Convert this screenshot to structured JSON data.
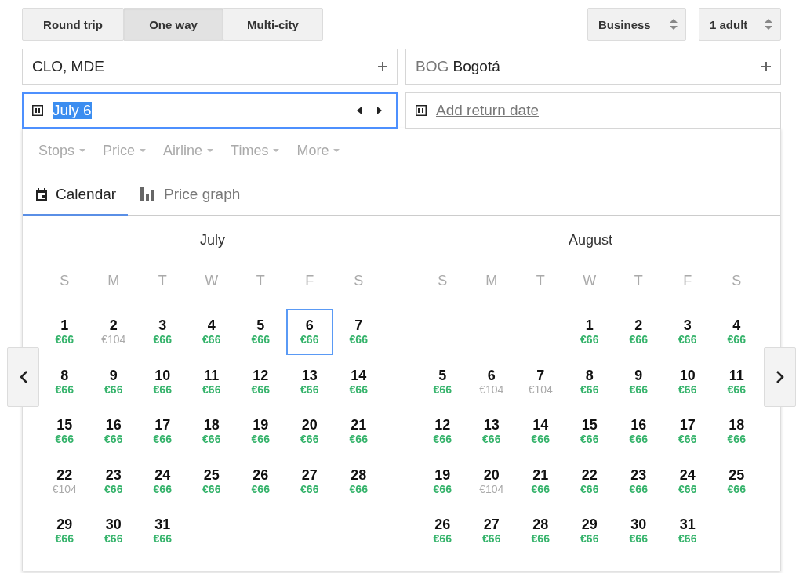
{
  "trip_types": [
    {
      "label": "Round trip",
      "selected": false
    },
    {
      "label": "One way",
      "selected": true
    },
    {
      "label": "Multi-city",
      "selected": false
    }
  ],
  "cabin": {
    "value": "Business"
  },
  "passengers": {
    "value": "1 adult"
  },
  "origin": {
    "value": "CLO, MDE"
  },
  "destination": {
    "code": "BOG",
    "city": "Bogotá"
  },
  "departure": {
    "value": "July 6"
  },
  "return_date": {
    "label": "Add return date"
  },
  "filters": [
    "Stops",
    "Price",
    "Airline",
    "Times",
    "More"
  ],
  "view_tabs": [
    {
      "label": "Calendar",
      "kind": "calendar",
      "selected": true
    },
    {
      "label": "Price graph",
      "kind": "graph",
      "selected": false
    }
  ],
  "months": [
    {
      "title": "July",
      "weekdays": [
        "S",
        "M",
        "T",
        "W",
        "T",
        "F",
        "S"
      ],
      "weeks": [
        [
          {
            "day": "1",
            "price": "€66",
            "low": true,
            "selected": false
          },
          {
            "day": "2",
            "price": "€104",
            "low": false,
            "selected": false
          },
          {
            "day": "3",
            "price": "€66",
            "low": true,
            "selected": false
          },
          {
            "day": "4",
            "price": "€66",
            "low": true,
            "selected": false
          },
          {
            "day": "5",
            "price": "€66",
            "low": true,
            "selected": false
          },
          {
            "day": "6",
            "price": "€66",
            "low": true,
            "selected": true
          },
          {
            "day": "7",
            "price": "€66",
            "low": true,
            "selected": false
          }
        ],
        [
          {
            "day": "8",
            "price": "€66",
            "low": true,
            "selected": false
          },
          {
            "day": "9",
            "price": "€66",
            "low": true,
            "selected": false
          },
          {
            "day": "10",
            "price": "€66",
            "low": true,
            "selected": false
          },
          {
            "day": "11",
            "price": "€66",
            "low": true,
            "selected": false
          },
          {
            "day": "12",
            "price": "€66",
            "low": true,
            "selected": false
          },
          {
            "day": "13",
            "price": "€66",
            "low": true,
            "selected": false
          },
          {
            "day": "14",
            "price": "€66",
            "low": true,
            "selected": false
          }
        ],
        [
          {
            "day": "15",
            "price": "€66",
            "low": true,
            "selected": false
          },
          {
            "day": "16",
            "price": "€66",
            "low": true,
            "selected": false
          },
          {
            "day": "17",
            "price": "€66",
            "low": true,
            "selected": false
          },
          {
            "day": "18",
            "price": "€66",
            "low": true,
            "selected": false
          },
          {
            "day": "19",
            "price": "€66",
            "low": true,
            "selected": false
          },
          {
            "day": "20",
            "price": "€66",
            "low": true,
            "selected": false
          },
          {
            "day": "21",
            "price": "€66",
            "low": true,
            "selected": false
          }
        ],
        [
          {
            "day": "22",
            "price": "€104",
            "low": false,
            "selected": false
          },
          {
            "day": "23",
            "price": "€66",
            "low": true,
            "selected": false
          },
          {
            "day": "24",
            "price": "€66",
            "low": true,
            "selected": false
          },
          {
            "day": "25",
            "price": "€66",
            "low": true,
            "selected": false
          },
          {
            "day": "26",
            "price": "€66",
            "low": true,
            "selected": false
          },
          {
            "day": "27",
            "price": "€66",
            "low": true,
            "selected": false
          },
          {
            "day": "28",
            "price": "€66",
            "low": true,
            "selected": false
          }
        ],
        [
          {
            "day": "29",
            "price": "€66",
            "low": true,
            "selected": false
          },
          {
            "day": "30",
            "price": "€66",
            "low": true,
            "selected": false
          },
          {
            "day": "31",
            "price": "€66",
            "low": true,
            "selected": false
          },
          {
            "kind": "blank"
          },
          {
            "kind": "blank"
          },
          {
            "kind": "blank"
          },
          {
            "kind": "blank"
          }
        ]
      ]
    },
    {
      "title": "August",
      "weekdays": [
        "S",
        "M",
        "T",
        "W",
        "T",
        "F",
        "S"
      ],
      "weeks": [
        [
          {
            "kind": "blank"
          },
          {
            "kind": "blank"
          },
          {
            "kind": "blank"
          },
          {
            "day": "1",
            "price": "€66",
            "low": true,
            "selected": false
          },
          {
            "day": "2",
            "price": "€66",
            "low": true,
            "selected": false
          },
          {
            "day": "3",
            "price": "€66",
            "low": true,
            "selected": false
          },
          {
            "day": "4",
            "price": "€66",
            "low": true,
            "selected": false
          }
        ],
        [
          {
            "day": "5",
            "price": "€66",
            "low": true,
            "selected": false
          },
          {
            "day": "6",
            "price": "€104",
            "low": false,
            "selected": false
          },
          {
            "day": "7",
            "price": "€104",
            "low": false,
            "selected": false
          },
          {
            "day": "8",
            "price": "€66",
            "low": true,
            "selected": false
          },
          {
            "day": "9",
            "price": "€66",
            "low": true,
            "selected": false
          },
          {
            "day": "10",
            "price": "€66",
            "low": true,
            "selected": false
          },
          {
            "day": "11",
            "price": "€66",
            "low": true,
            "selected": false
          }
        ],
        [
          {
            "day": "12",
            "price": "€66",
            "low": true,
            "selected": false
          },
          {
            "day": "13",
            "price": "€66",
            "low": true,
            "selected": false
          },
          {
            "day": "14",
            "price": "€66",
            "low": true,
            "selected": false
          },
          {
            "day": "15",
            "price": "€66",
            "low": true,
            "selected": false
          },
          {
            "day": "16",
            "price": "€66",
            "low": true,
            "selected": false
          },
          {
            "day": "17",
            "price": "€66",
            "low": true,
            "selected": false
          },
          {
            "day": "18",
            "price": "€66",
            "low": true,
            "selected": false
          }
        ],
        [
          {
            "day": "19",
            "price": "€66",
            "low": true,
            "selected": false
          },
          {
            "day": "20",
            "price": "€104",
            "low": false,
            "selected": false
          },
          {
            "day": "21",
            "price": "€66",
            "low": true,
            "selected": false
          },
          {
            "day": "22",
            "price": "€66",
            "low": true,
            "selected": false
          },
          {
            "day": "23",
            "price": "€66",
            "low": true,
            "selected": false
          },
          {
            "day": "24",
            "price": "€66",
            "low": true,
            "selected": false
          },
          {
            "day": "25",
            "price": "€66",
            "low": true,
            "selected": false
          }
        ],
        [
          {
            "day": "26",
            "price": "€66",
            "low": true,
            "selected": false
          },
          {
            "day": "27",
            "price": "€66",
            "low": true,
            "selected": false
          },
          {
            "day": "28",
            "price": "€66",
            "low": true,
            "selected": false
          },
          {
            "day": "29",
            "price": "€66",
            "low": true,
            "selected": false
          },
          {
            "day": "30",
            "price": "€66",
            "low": true,
            "selected": false
          },
          {
            "day": "31",
            "price": "€66",
            "low": true,
            "selected": false
          },
          {
            "kind": "blank"
          }
        ]
      ]
    }
  ]
}
